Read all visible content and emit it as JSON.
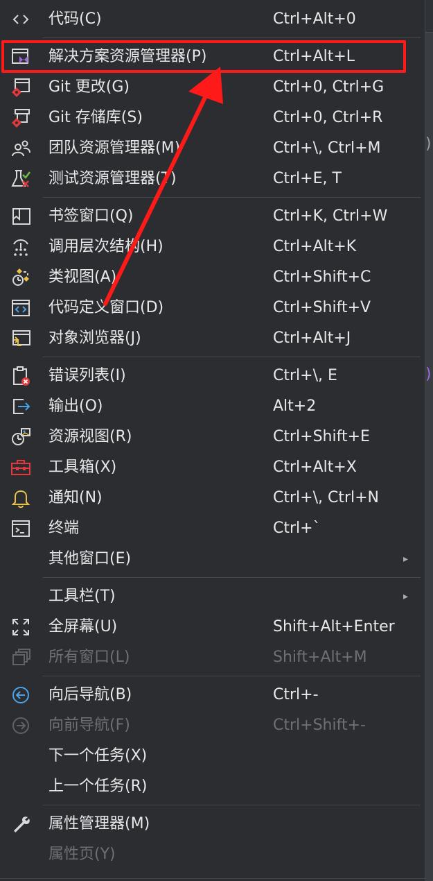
{
  "menu": {
    "items": [
      {
        "key": "code",
        "label": "代码(C)",
        "shortcut": "Ctrl+Alt+0",
        "icon": "code-brackets-icon"
      },
      {
        "key": "solution-explorer",
        "label": "解决方案资源管理器(P)",
        "shortcut": "Ctrl+Alt+L",
        "icon": "solution-explorer-icon"
      },
      {
        "key": "git-changes",
        "label": "Git 更改(G)",
        "shortcut": "Ctrl+0, Ctrl+G",
        "icon": "git-changes-icon"
      },
      {
        "key": "git-repository",
        "label": "Git 存储库(S)",
        "shortcut": "Ctrl+0, Ctrl+R",
        "icon": "git-repository-icon"
      },
      {
        "key": "team-explorer",
        "label": "团队资源管理器(M)",
        "shortcut": "Ctrl+\\, Ctrl+M",
        "icon": "team-explorer-icon"
      },
      {
        "key": "test-explorer",
        "label": "测试资源管理器(T)",
        "shortcut": "Ctrl+E, T",
        "icon": "test-explorer-icon"
      },
      {
        "key": "bookmark-window",
        "label": "书签窗口(Q)",
        "shortcut": "Ctrl+K, Ctrl+W",
        "icon": "bookmark-icon"
      },
      {
        "key": "call-hierarchy",
        "label": "调用层次结构(H)",
        "shortcut": "Ctrl+Alt+K",
        "icon": "call-hierarchy-icon"
      },
      {
        "key": "class-view",
        "label": "类视图(A)",
        "shortcut": "Ctrl+Shift+C",
        "icon": "class-view-icon"
      },
      {
        "key": "code-definition",
        "label": "代码定义窗口(D)",
        "shortcut": "Ctrl+Shift+V",
        "icon": "code-definition-icon"
      },
      {
        "key": "object-browser",
        "label": "对象浏览器(J)",
        "shortcut": "Ctrl+Alt+J",
        "icon": "object-browser-icon"
      },
      {
        "key": "error-list",
        "label": "错误列表(I)",
        "shortcut": "Ctrl+\\, E",
        "icon": "error-list-icon"
      },
      {
        "key": "output",
        "label": "输出(O)",
        "shortcut": "Alt+2",
        "icon": "output-icon"
      },
      {
        "key": "resource-view",
        "label": "资源视图(R)",
        "shortcut": "Ctrl+Shift+E",
        "icon": "resource-view-icon"
      },
      {
        "key": "toolbox",
        "label": "工具箱(X)",
        "shortcut": "Ctrl+Alt+X",
        "icon": "toolbox-icon"
      },
      {
        "key": "notifications",
        "label": "通知(N)",
        "shortcut": "Ctrl+\\, Ctrl+N",
        "icon": "bell-icon"
      },
      {
        "key": "terminal",
        "label": "终端",
        "shortcut": "Ctrl+`",
        "icon": "terminal-icon"
      },
      {
        "key": "other-windows",
        "label": "其他窗口(E)",
        "shortcut": "",
        "icon": ""
      },
      {
        "key": "toolbars",
        "label": "工具栏(T)",
        "shortcut": "",
        "icon": ""
      },
      {
        "key": "full-screen",
        "label": "全屏幕(U)",
        "shortcut": "Shift+Alt+Enter",
        "icon": "full-screen-icon"
      },
      {
        "key": "all-windows",
        "label": "所有窗口(L)",
        "shortcut": "Shift+Alt+M",
        "icon": "all-windows-icon"
      },
      {
        "key": "navigate-backward",
        "label": "向后导航(B)",
        "shortcut": "Ctrl+-",
        "icon": "navigate-back-icon"
      },
      {
        "key": "navigate-forward",
        "label": "向前导航(F)",
        "shortcut": "Ctrl+Shift+-",
        "icon": "navigate-forward-icon"
      },
      {
        "key": "next-task",
        "label": "下一个任务(X)",
        "shortcut": "",
        "icon": ""
      },
      {
        "key": "previous-task",
        "label": "上一个任务(R)",
        "shortcut": "",
        "icon": ""
      },
      {
        "key": "property-manager",
        "label": "属性管理器(M)",
        "shortcut": "",
        "icon": "wrench-icon"
      },
      {
        "key": "property-pages",
        "label": "属性页(Y)",
        "shortcut": "",
        "icon": ""
      }
    ],
    "submenu_arrow": "▸"
  },
  "colors": {
    "background": "#2b2d30",
    "text": "#e8e8e8",
    "disabled_text": "#6d7075",
    "annotation_red": "#ff1a1a",
    "icon_blue": "#4aa3e8",
    "icon_purple": "#9b6bd6",
    "icon_red": "#e0393e",
    "icon_yellow": "#e8c14a"
  },
  "annotation": {
    "highlighted_item": "解决方案资源管理器(P)"
  }
}
